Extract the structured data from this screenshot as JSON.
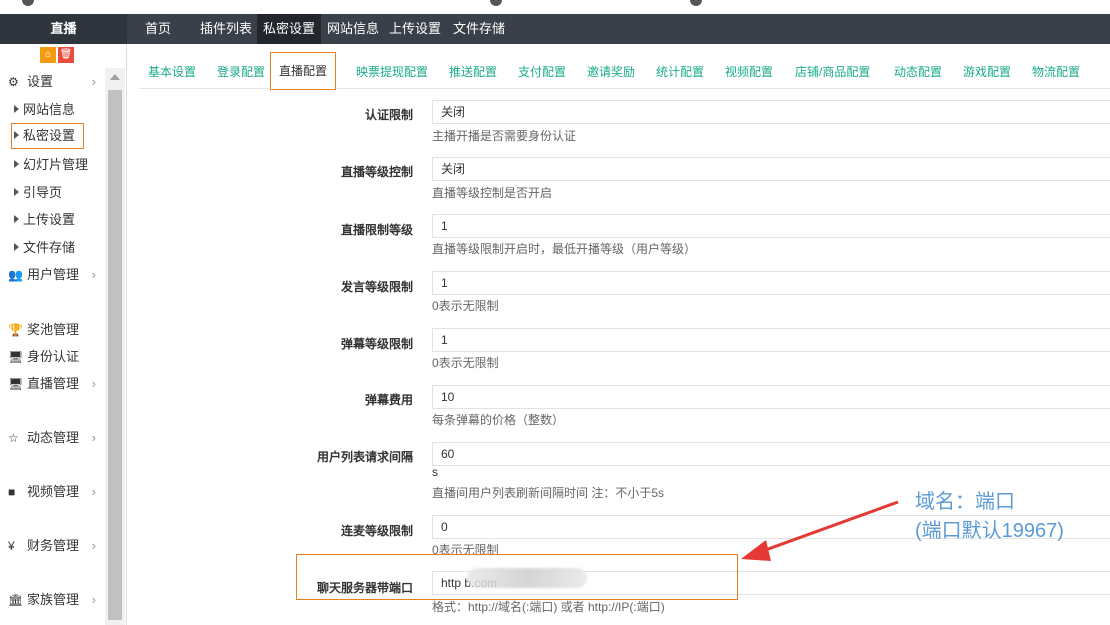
{
  "navbar": {
    "brand": "直播",
    "items": [
      {
        "label": "首页"
      },
      {
        "label": "插件列表"
      },
      {
        "label": "私密设置"
      },
      {
        "label": "网站信息"
      },
      {
        "label": "上传设置"
      },
      {
        "label": "文件存储"
      }
    ],
    "active": "私密设置"
  },
  "sidebar": {
    "settings_label": "设置",
    "sub_items": [
      {
        "label": "网站信息"
      },
      {
        "label": "私密设置"
      },
      {
        "label": "幻灯片管理"
      },
      {
        "label": "引导页"
      },
      {
        "label": "上传设置"
      },
      {
        "label": "文件存储"
      }
    ],
    "menu": [
      {
        "label": "用户管理",
        "icon": "users-icon"
      },
      {
        "label": "奖池管理",
        "icon": "trophy-icon"
      },
      {
        "label": "身份认证",
        "icon": "monitor-icon"
      },
      {
        "label": "直播管理",
        "icon": "monitor-icon"
      },
      {
        "label": "动态管理",
        "icon": "star-icon"
      },
      {
        "label": "视频管理",
        "icon": "video-camera-icon"
      },
      {
        "label": "财务管理",
        "icon": "yen-icon"
      },
      {
        "label": "家族管理",
        "icon": "institution-icon"
      }
    ]
  },
  "tabs": [
    {
      "label": "基本设置"
    },
    {
      "label": "登录配置"
    },
    {
      "label": "直播配置"
    },
    {
      "label": "映票提现配置"
    },
    {
      "label": "推送配置"
    },
    {
      "label": "支付配置"
    },
    {
      "label": "邀请奖励"
    },
    {
      "label": "统计配置"
    },
    {
      "label": "视频配置"
    },
    {
      "label": "店铺/商品配置"
    },
    {
      "label": "动态配置"
    },
    {
      "label": "游戏配置"
    },
    {
      "label": "物流配置"
    }
  ],
  "active_tab": "直播配置",
  "form": {
    "rows": [
      {
        "label": "认证限制",
        "value": "关闭",
        "help": "主播开播是否需要身份认证"
      },
      {
        "label": "直播等级控制",
        "value": "关闭",
        "help": "直播等级控制是否开启"
      },
      {
        "label": "直播限制等级",
        "value": "1",
        "help": "直播等级限制开启时，最低开播等级（用户等级）"
      },
      {
        "label": "发言等级限制",
        "value": "1",
        "help": "0表示无限制"
      },
      {
        "label": "弹幕等级限制",
        "value": "1",
        "help": "0表示无限制"
      },
      {
        "label": "弹幕费用",
        "value": "10",
        "help": "每条弹幕的价格（整数）"
      },
      {
        "label": "用户列表请求间隔",
        "value": "60",
        "unit": "s",
        "help": "直播间用户列表刷新间隔时间 注：不小于5s"
      },
      {
        "label": "连麦等级限制",
        "value": "0",
        "help": "0表示无限制"
      },
      {
        "label": "聊天服务器带端口",
        "value": "http                               b.com",
        "help": "格式：http://域名(:端口) 或者 http://IP(:端口)"
      }
    ]
  },
  "annotation": {
    "line1": "域名：端口",
    "line2": "(端口默认19967)",
    "color": "#5b9bd5"
  },
  "colors": {
    "navbar": "#3a4049",
    "tab_text": "#1aab8a",
    "highlight": "#e67e22",
    "arrow": "#e53935"
  }
}
